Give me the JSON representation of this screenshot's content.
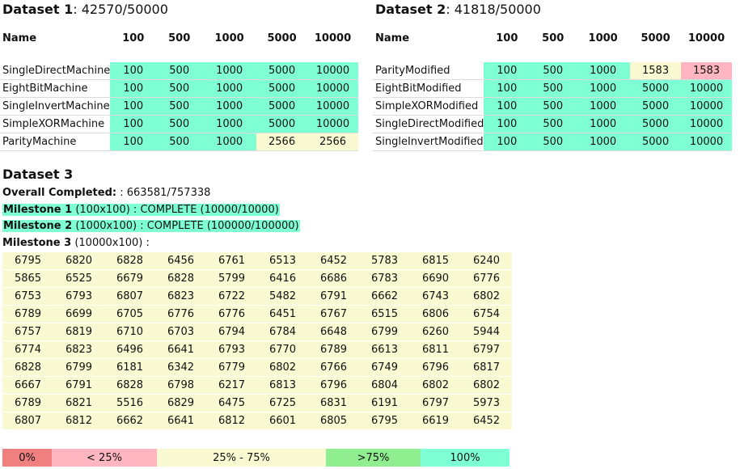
{
  "dataset1": {
    "title": "Dataset 1",
    "score": ": 42570/50000",
    "headers": [
      "Name",
      "100",
      "500",
      "1000",
      "5000",
      "10000"
    ],
    "rows": [
      {
        "name": "SingleDirectMachine",
        "values": [
          "100",
          "500",
          "1000",
          "5000",
          "10000"
        ],
        "levels": [
          "c100",
          "c100",
          "c100",
          "c100",
          "c100"
        ]
      },
      {
        "name": "EightBitMachine",
        "values": [
          "100",
          "500",
          "1000",
          "5000",
          "10000"
        ],
        "levels": [
          "c100",
          "c100",
          "c100",
          "c100",
          "c100"
        ]
      },
      {
        "name": "SingleInvertMachine",
        "values": [
          "100",
          "500",
          "1000",
          "5000",
          "10000"
        ],
        "levels": [
          "c100",
          "c100",
          "c100",
          "c100",
          "c100"
        ]
      },
      {
        "name": "SimpleXORMachine",
        "values": [
          "100",
          "500",
          "1000",
          "5000",
          "10000"
        ],
        "levels": [
          "c100",
          "c100",
          "c100",
          "c100",
          "c100"
        ]
      },
      {
        "name": "ParityMachine",
        "values": [
          "100",
          "500",
          "1000",
          "2566",
          "2566"
        ],
        "levels": [
          "c100",
          "c100",
          "c100",
          "c50",
          "c50"
        ]
      }
    ]
  },
  "dataset2": {
    "title": "Dataset 2",
    "score": ": 41818/50000",
    "headers": [
      "Name",
      "100",
      "500",
      "1000",
      "5000",
      "10000"
    ],
    "rows": [
      {
        "name": "ParityModified",
        "values": [
          "100",
          "500",
          "1000",
          "1583",
          "1583"
        ],
        "levels": [
          "c100",
          "c100",
          "c100",
          "c50",
          "c25"
        ]
      },
      {
        "name": "EightBitModified",
        "values": [
          "100",
          "500",
          "1000",
          "5000",
          "10000"
        ],
        "levels": [
          "c100",
          "c100",
          "c100",
          "c100",
          "c100"
        ]
      },
      {
        "name": "SimpleXORModified",
        "values": [
          "100",
          "500",
          "1000",
          "5000",
          "10000"
        ],
        "levels": [
          "c100",
          "c100",
          "c100",
          "c100",
          "c100"
        ]
      },
      {
        "name": "SingleDirectModified",
        "values": [
          "100",
          "500",
          "1000",
          "5000",
          "10000"
        ],
        "levels": [
          "c100",
          "c100",
          "c100",
          "c100",
          "c100"
        ]
      },
      {
        "name": "SingleInvertModified",
        "values": [
          "100",
          "500",
          "1000",
          "5000",
          "10000"
        ],
        "levels": [
          "c100",
          "c100",
          "c100",
          "c100",
          "c100"
        ]
      }
    ]
  },
  "dataset3": {
    "title": "Dataset 3",
    "overall_label": "Overall Completed:",
    "overall_value": " : 663581/757338",
    "milestone1_label": "Milestone 1",
    "milestone1_text": " (100x100) : COMPLETE (10000/10000)",
    "milestone2_label": "Milestone 2",
    "milestone2_text": " (1000x100) : COMPLETE (100000/100000)",
    "milestone3_label": "Milestone 3",
    "milestone3_text": " (10000x100) :",
    "grid": [
      [
        "6795",
        "6820",
        "6828",
        "6456",
        "6761",
        "6513",
        "6452",
        "5783",
        "6815",
        "6240"
      ],
      [
        "5865",
        "6525",
        "6679",
        "6828",
        "5799",
        "6416",
        "6686",
        "6783",
        "6690",
        "6776"
      ],
      [
        "6753",
        "6793",
        "6807",
        "6823",
        "6722",
        "5482",
        "6791",
        "6662",
        "6743",
        "6802"
      ],
      [
        "6789",
        "6699",
        "6705",
        "6776",
        "6776",
        "6451",
        "6767",
        "6515",
        "6806",
        "6754"
      ],
      [
        "6757",
        "6819",
        "6710",
        "6703",
        "6794",
        "6784",
        "6648",
        "6799",
        "6260",
        "5944"
      ],
      [
        "6774",
        "6823",
        "6496",
        "6641",
        "6793",
        "6770",
        "6789",
        "6613",
        "6811",
        "6797"
      ],
      [
        "6828",
        "6799",
        "6181",
        "6342",
        "6779",
        "6802",
        "6766",
        "6749",
        "6796",
        "6817"
      ],
      [
        "6667",
        "6791",
        "6828",
        "6798",
        "6217",
        "6813",
        "6796",
        "6804",
        "6802",
        "6802"
      ],
      [
        "6789",
        "6821",
        "5516",
        "6829",
        "6475",
        "6725",
        "6831",
        "6191",
        "6797",
        "5973"
      ],
      [
        "6807",
        "6812",
        "6662",
        "6641",
        "6812",
        "6601",
        "6805",
        "6795",
        "6619",
        "6452"
      ]
    ]
  },
  "legend": [
    {
      "label": "0%",
      "color": "#f08080"
    },
    {
      "label": "< 25%",
      "color": "#ffb6c1"
    },
    {
      "label": "25% - 75%",
      "color": "#fafad2"
    },
    {
      "label": ">75%",
      "color": "#90ee90"
    },
    {
      "label": "100%",
      "color": "#7fffd4"
    }
  ]
}
